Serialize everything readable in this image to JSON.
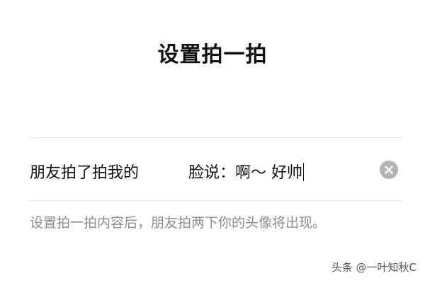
{
  "page": {
    "title": "设置拍一拍"
  },
  "tickle_setting": {
    "prefix": "朋友拍了拍我的",
    "value": "脸说：啊～ 好帅",
    "hint": "设置拍一拍内容后，朋友拍两下你的头像将出现。"
  },
  "clear_icon": "close-circle-icon",
  "watermark": {
    "text": "头条 @一叶知秋C"
  },
  "colors": {
    "text": "#111111",
    "hint": "#8c8c8c",
    "divider": "#e6e6e6",
    "clear_button": "#b4b4b4"
  }
}
